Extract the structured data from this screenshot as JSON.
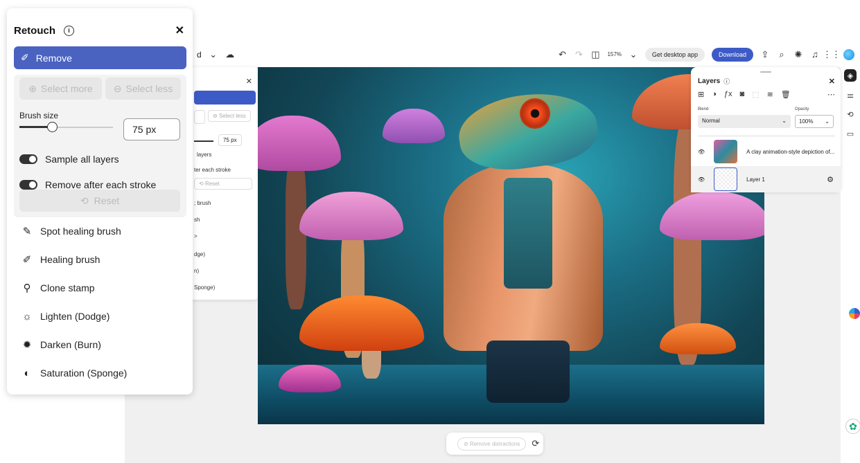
{
  "retouch_panel": {
    "title": "Retouch",
    "remove_label": "Remove",
    "select_more": "Select more",
    "select_less": "Select less",
    "brush_size_label": "Brush size",
    "brush_size_value": "75 px",
    "brush_slider_fraction": 0.35,
    "sample_all_layers": "Sample all layers",
    "remove_after_stroke": "Remove after each stroke",
    "reset": "Reset",
    "tools": [
      {
        "label": "Spot healing brush",
        "icon": "spot-healing-icon"
      },
      {
        "label": "Healing brush",
        "icon": "healing-brush-icon"
      },
      {
        "label": "Clone stamp",
        "icon": "clone-stamp-icon"
      },
      {
        "label": "Lighten (Dodge)",
        "icon": "sun-outline-icon"
      },
      {
        "label": "Darken (Burn)",
        "icon": "sun-filled-icon"
      },
      {
        "label": "Saturation (Sponge)",
        "icon": "saturation-icon"
      }
    ]
  },
  "bg_panel": {
    "select_less": "Select less",
    "size": "75 px",
    "sample_partial": "layers",
    "remove_partial": "ter each stroke",
    "reset": "Reset",
    "partial_items": [
      "; brush",
      "sh",
      ">",
      "dge)",
      "n)",
      "Sponge)"
    ]
  },
  "topbar": {
    "zoom": "157%",
    "get_desktop": "Get desktop app",
    "download": "Download",
    "left_partial": "d"
  },
  "layers_panel": {
    "title": "Layers",
    "blend_label": "Blend",
    "blend_value": "Normal",
    "opacity_label": "Opacity",
    "opacity_value": "100%",
    "layers": [
      {
        "name": "A clay animation-style depiction of..."
      },
      {
        "name": "Layer 1"
      }
    ]
  },
  "bottom_bar": {
    "remove_distractions": "Remove distractions"
  },
  "colors": {
    "accent": "#4a62c0",
    "download": "#3d5bc6"
  }
}
